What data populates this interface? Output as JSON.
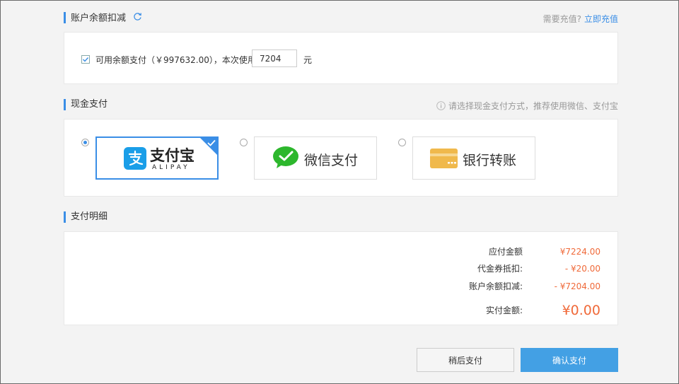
{
  "balance_section": {
    "title": "账户余额扣减",
    "recharge_prompt": "需要充值?",
    "recharge_link": "立即充值",
    "checkbox_checked": true,
    "available_text": "可用余额支付（￥997632.00），本次使用",
    "use_amount": "7204",
    "unit": "元"
  },
  "cash_section": {
    "title": "现金支付",
    "hint": "请选择现金支付方式，推荐使用微信、支付宝",
    "methods": [
      {
        "name": "alipay",
        "label": "支付宝",
        "sub": "ALIPAY",
        "selected": true
      },
      {
        "name": "wechat",
        "label": "微信支付",
        "selected": false
      },
      {
        "name": "bank",
        "label": "银行转账",
        "selected": false
      }
    ]
  },
  "detail_section": {
    "title": "支付明细",
    "rows": [
      {
        "label": "应付金额",
        "value": "¥7224.00"
      },
      {
        "label": "代金券抵扣:",
        "value": "- ¥20.00"
      },
      {
        "label": "账户余额扣减:",
        "value": "- ¥7204.00"
      }
    ],
    "total_label": "实付金额:",
    "total_value": "¥0.00"
  },
  "buttons": {
    "later": "稍后支付",
    "confirm": "确认支付"
  },
  "colors": {
    "accent": "#3a8ee6",
    "amount": "#f06a3a",
    "alipay": "#1a9ee8",
    "wechat": "#2db72d",
    "bank": "#f0b94c"
  }
}
